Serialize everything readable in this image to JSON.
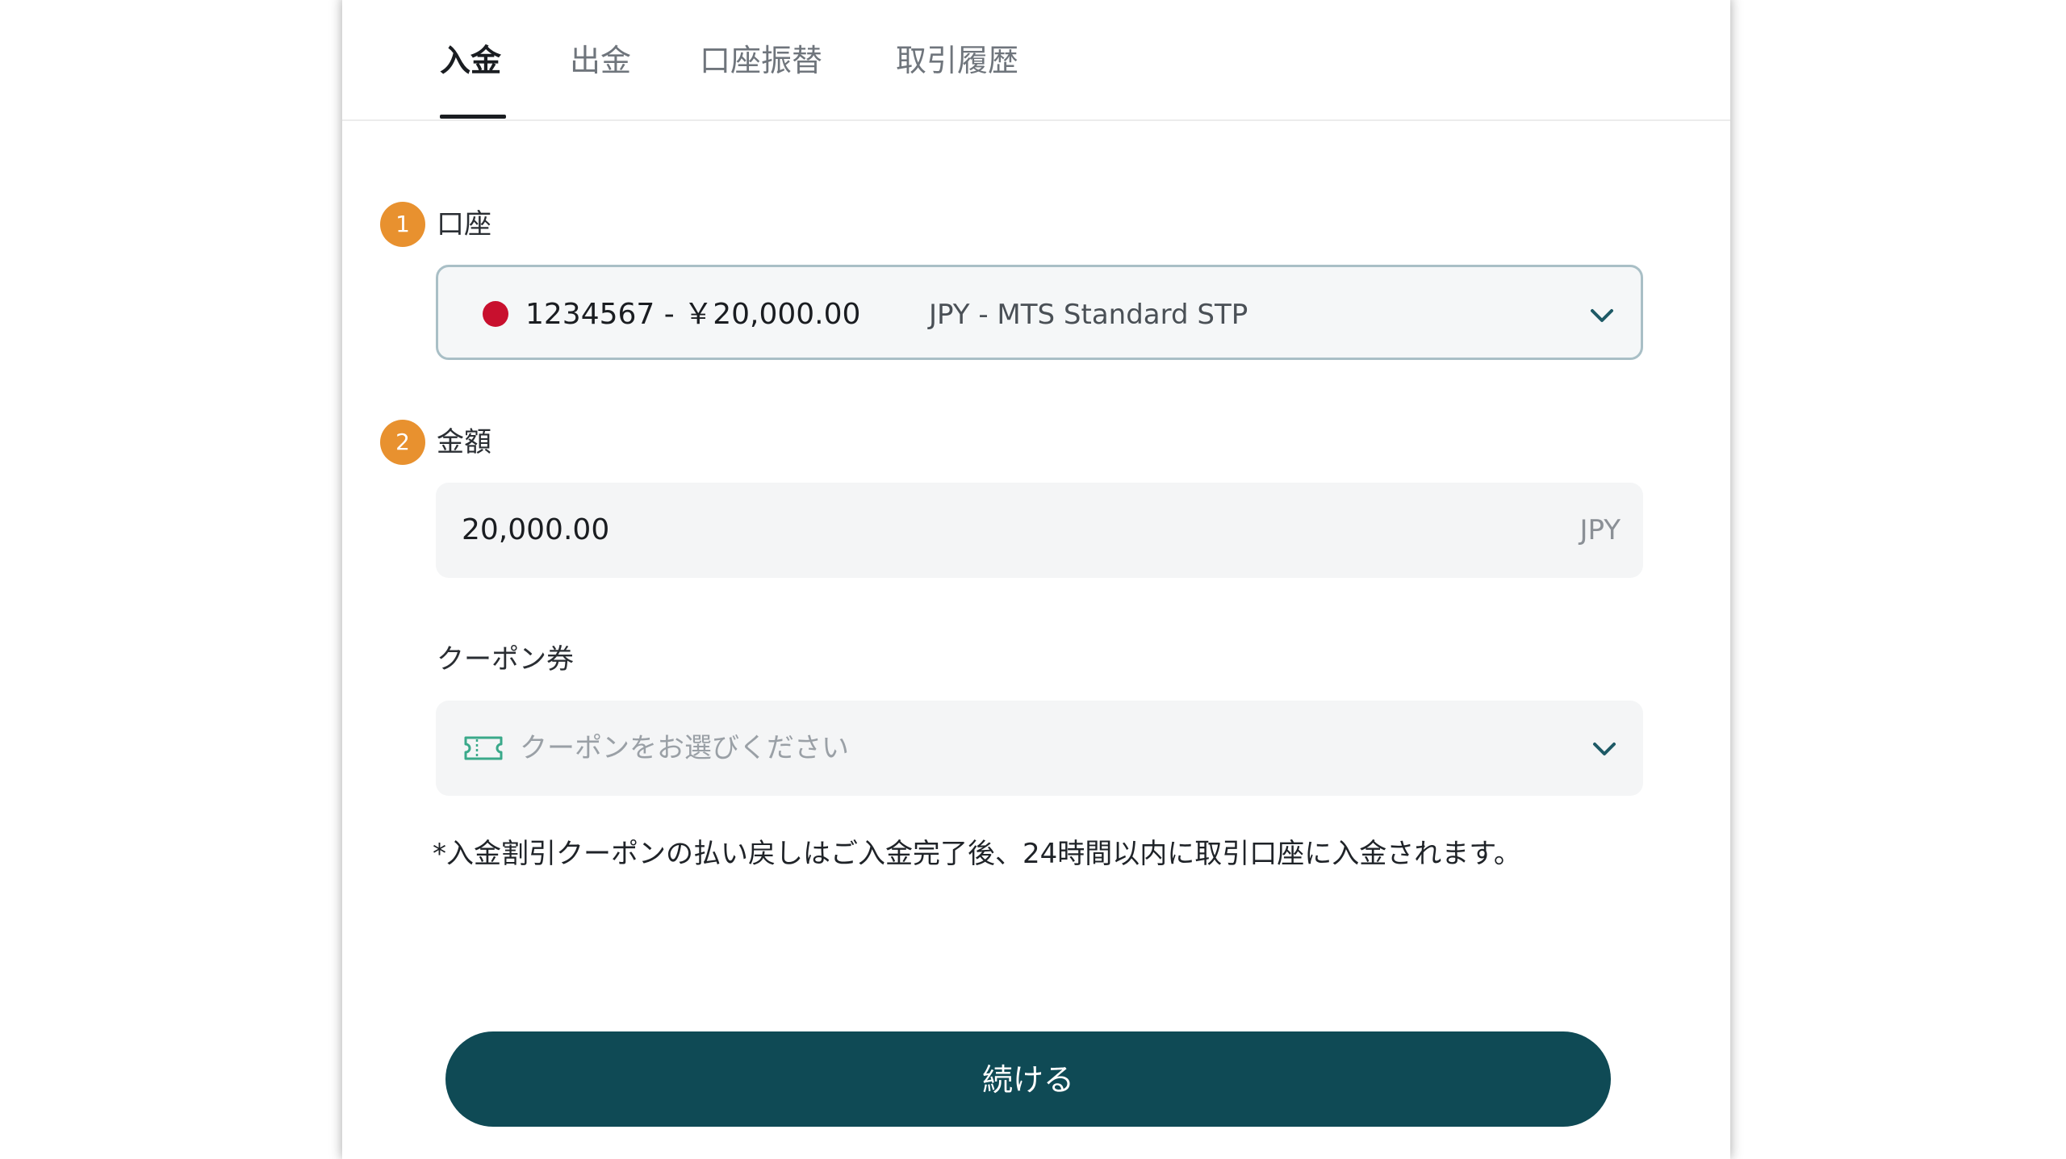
{
  "tabs": [
    {
      "label": "入金",
      "active": true
    },
    {
      "label": "出金",
      "active": false
    },
    {
      "label": "口座振替",
      "active": false
    },
    {
      "label": "取引履歴",
      "active": false
    }
  ],
  "account": {
    "step_number": "1",
    "label": "口座",
    "selected_primary": "1234567 - ￥20,000.00",
    "selected_secondary": "JPY - MTS Standard STP",
    "icon": "chevron-down-icon"
  },
  "amount": {
    "step_number": "2",
    "label": "金額",
    "value": "20,000.00",
    "currency": "JPY"
  },
  "coupon": {
    "label": "クーポン券",
    "placeholder": "クーポンをお選びください",
    "icon": "ticket-icon"
  },
  "note": "*入金割引クーポンの払い戻しはご入金完了後、24時間以内に取引口座に入金されます。",
  "continue_label": "続ける",
  "colors": {
    "step_badge": "#e8912f",
    "flag": "#c8102e",
    "button": "#0f4a55",
    "chevron": "#1e5a66",
    "ticket": "#3aa98a"
  }
}
